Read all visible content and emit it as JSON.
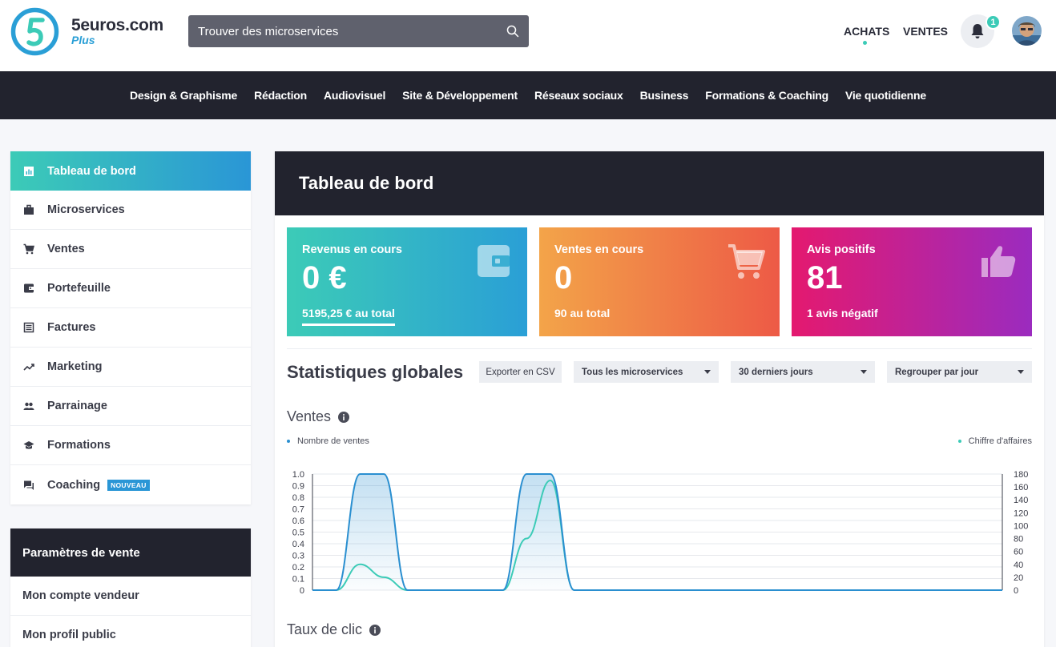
{
  "header": {
    "brand_name": "5euros.com",
    "brand_sub": "Plus",
    "search_placeholder": "Trouver des microservices",
    "nav_achats": "ACHATS",
    "nav_ventes": "VENTES",
    "notification_count": "1"
  },
  "categories": [
    "Design & Graphisme",
    "Rédaction",
    "Audiovisuel",
    "Site & Développement",
    "Réseaux sociaux",
    "Business",
    "Formations & Coaching",
    "Vie quotidienne"
  ],
  "sidebar": {
    "items": [
      {
        "label": "Tableau de bord",
        "icon": "bar-chart-icon"
      },
      {
        "label": "Microservices",
        "icon": "briefcase-icon"
      },
      {
        "label": "Ventes",
        "icon": "cart-icon"
      },
      {
        "label": "Portefeuille",
        "icon": "wallet-icon"
      },
      {
        "label": "Factures",
        "icon": "invoice-icon"
      },
      {
        "label": "Marketing",
        "icon": "trending-icon"
      },
      {
        "label": "Parrainage",
        "icon": "people-icon"
      },
      {
        "label": "Formations",
        "icon": "graduation-icon"
      },
      {
        "label": "Coaching",
        "icon": "chat-icon",
        "tag": "NOUVEAU"
      }
    ],
    "sales_params_title": "Paramètres de vente",
    "sales_params_items": [
      "Mon compte vendeur",
      "Mon profil public"
    ]
  },
  "main": {
    "title": "Tableau de bord",
    "cards": [
      {
        "label": "Revenus en cours",
        "value": "0 €",
        "sub": "5195,25 € au total"
      },
      {
        "label": "Ventes en cours",
        "value": "0",
        "sub": "90 au total"
      },
      {
        "label": "Avis positifs",
        "value": "81",
        "sub": "1 avis négatif"
      }
    ],
    "stats_title": "Statistiques globales",
    "export_label": "Exporter en CSV",
    "select_services": "Tous les microservices",
    "select_period": "30 derniers jours",
    "select_group": "Regrouper par jour",
    "ventes_title": "Ventes",
    "clic_title": "Taux de clic",
    "colors": {
      "sales": "#2a8fd0",
      "revenue": "#3ccbb7"
    }
  },
  "chart_data": {
    "type": "line",
    "legend": [
      "Nombre de ventes",
      "Chiffre d'affaires"
    ],
    "y_left_ticks": [
      "1.0",
      "0.9",
      "0.8",
      "0.7",
      "0.6",
      "0.5",
      "0.4",
      "0.3",
      "0.2",
      "0.1",
      "0"
    ],
    "y_right_ticks": [
      "180",
      "160",
      "140",
      "120",
      "100",
      "80",
      "60",
      "40",
      "20",
      "0"
    ],
    "ylim_left": [
      0,
      1
    ],
    "ylim_right": [
      0,
      180
    ],
    "series": [
      {
        "name": "Nombre de ventes",
        "axis": "left",
        "values": [
          0,
          0,
          1,
          1,
          0,
          0,
          0,
          0,
          0,
          1,
          1,
          0,
          0,
          0,
          0,
          0,
          0,
          0,
          0,
          0,
          0,
          0,
          0,
          0,
          0,
          0,
          0,
          0,
          0,
          0
        ]
      },
      {
        "name": "Chiffre d'affaires",
        "axis": "right",
        "values": [
          0,
          0,
          40,
          20,
          0,
          0,
          0,
          0,
          0,
          80,
          170,
          0,
          0,
          0,
          0,
          0,
          0,
          0,
          0,
          0,
          0,
          0,
          0,
          0,
          0,
          0,
          0,
          0,
          0,
          0
        ]
      }
    ]
  }
}
